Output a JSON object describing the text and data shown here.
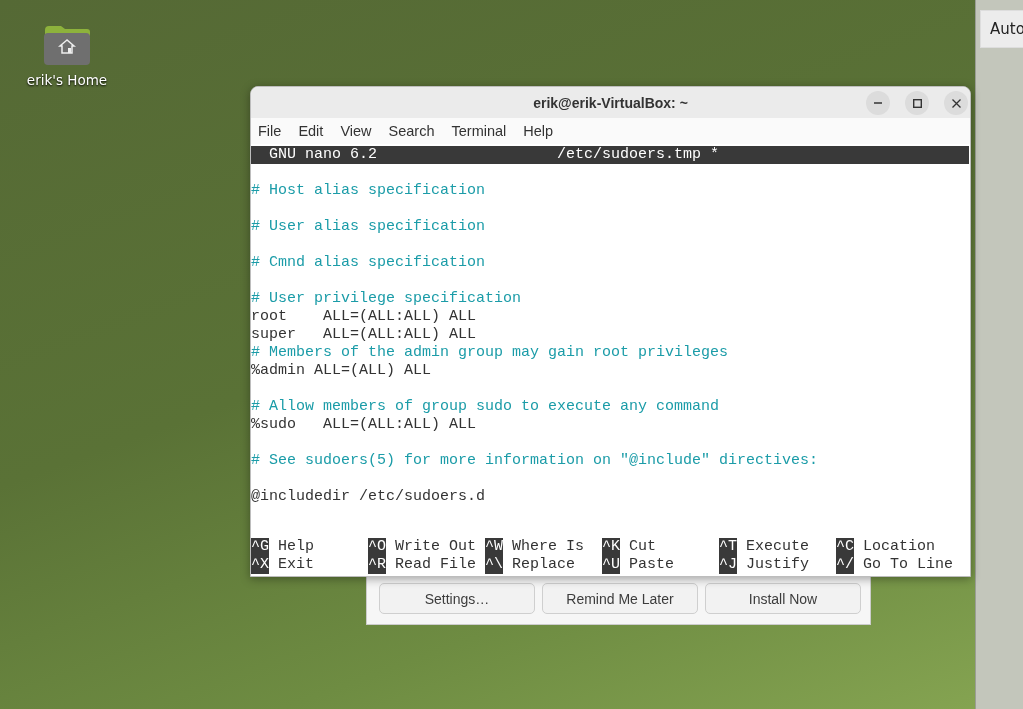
{
  "desktop": {
    "icons": [
      {
        "label": "erik's Home"
      }
    ]
  },
  "side_window": {
    "button": "Auto"
  },
  "update_dialog": {
    "buttons": [
      "Settings…",
      "Remind Me Later",
      "Install Now"
    ]
  },
  "terminal": {
    "title": "erik@erik-VirtualBox: ~",
    "menu": [
      "File",
      "Edit",
      "View",
      "Search",
      "Terminal",
      "Help"
    ],
    "nano_header": {
      "version": "GNU nano 6.2",
      "file": "/etc/sudoers.tmp *"
    },
    "lines": [
      {
        "kind": "blank"
      },
      {
        "kind": "comment",
        "text": "# Host alias specification"
      },
      {
        "kind": "blank"
      },
      {
        "kind": "comment",
        "text": "# User alias specification"
      },
      {
        "kind": "blank"
      },
      {
        "kind": "comment",
        "text": "# Cmnd alias specification"
      },
      {
        "kind": "blank"
      },
      {
        "kind": "comment",
        "text": "# User privilege specification"
      },
      {
        "kind": "code",
        "text": "root    ALL=(ALL:ALL) ALL"
      },
      {
        "kind": "code",
        "text": "super   ALL=(ALL:ALL) ALL"
      },
      {
        "kind": "comment",
        "text": "# Members of the admin group may gain root privileges"
      },
      {
        "kind": "code",
        "text": "%admin ALL=(ALL) ALL"
      },
      {
        "kind": "blank"
      },
      {
        "kind": "comment",
        "text": "# Allow members of group sudo to execute any command"
      },
      {
        "kind": "code",
        "text": "%sudo   ALL=(ALL:ALL) ALL"
      },
      {
        "kind": "blank"
      },
      {
        "kind": "comment",
        "text": "# See sudoers(5) for more information on \"@include\" directives:"
      },
      {
        "kind": "blank"
      },
      {
        "kind": "code",
        "text": "@includedir /etc/sudoers.d"
      }
    ],
    "shortcuts": [
      {
        "key": "^G",
        "label": "Help"
      },
      {
        "key": "^O",
        "label": "Write Out"
      },
      {
        "key": "^W",
        "label": "Where Is"
      },
      {
        "key": "^K",
        "label": "Cut"
      },
      {
        "key": "^T",
        "label": "Execute"
      },
      {
        "key": "^C",
        "label": "Location"
      },
      {
        "key": "^X",
        "label": "Exit"
      },
      {
        "key": "^R",
        "label": "Read File"
      },
      {
        "key": "^\\",
        "label": "Replace"
      },
      {
        "key": "^U",
        "label": "Paste"
      },
      {
        "key": "^J",
        "label": "Justify"
      },
      {
        "key": "^/",
        "label": "Go To Line"
      }
    ]
  }
}
